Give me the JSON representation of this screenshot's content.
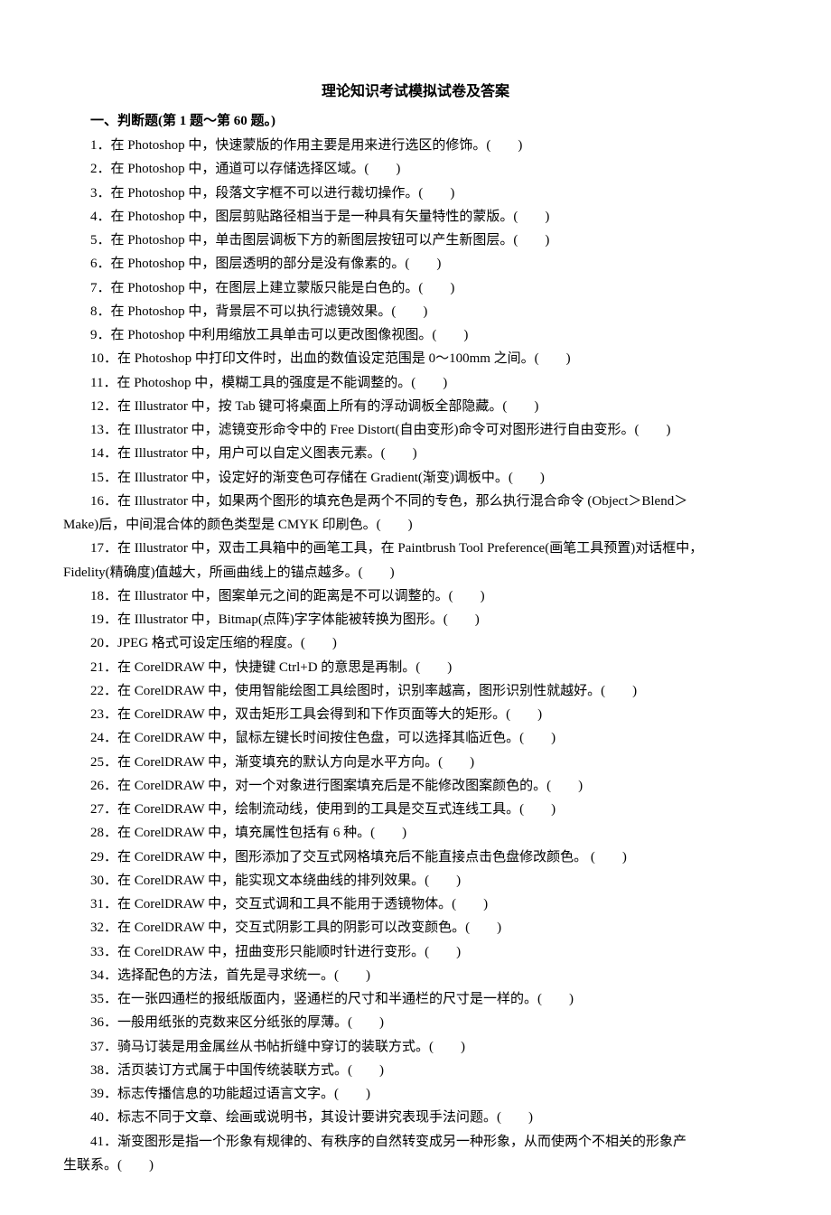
{
  "title": "理论知识考试模拟试卷及答案",
  "section_header": "一、判断题(第 1 题～第 60 题。)",
  "questions": {
    "q1": "1．在 Photoshop 中，快速蒙版的作用主要是用来进行选区的修饰。(　　)",
    "q2": "2．在 Photoshop 中，通道可以存储选择区域。(　　)",
    "q3": "3．在 Photoshop 中，段落文字框不可以进行裁切操作。(　　)",
    "q4": "4．在 Photoshop 中，图层剪贴路径相当于是一种具有矢量特性的蒙版。(　　)",
    "q5": "5．在 Photoshop 中，单击图层调板下方的新图层按钮可以产生新图层。(　　)",
    "q6": "6．在 Photoshop 中，图层透明的部分是没有像素的。(　　)",
    "q7": "7．在 Photoshop 中，在图层上建立蒙版只能是白色的。(　　)",
    "q8": "8．在 Photoshop 中，背景层不可以执行滤镜效果。(　　)",
    "q9": "9．在 Photoshop 中利用缩放工具单击可以更改图像视图。(　　)",
    "q10": "10．在 Photoshop 中打印文件时，出血的数值设定范围是 0～100mm 之间。(　　)",
    "q11": "11．在 Photoshop 中，模糊工具的强度是不能调整的。(　　)",
    "q12": "12．在 Illustrator 中，按 Tab 键可将桌面上所有的浮动调板全部隐藏。(　　)",
    "q13": "13．在 Illustrator 中，滤镜变形命令中的 Free Distort(自由变形)命令可对图形进行自由变形。(　　)",
    "q14": "14．在 Illustrator 中，用户可以自定义图表元素。(　　)",
    "q15": "15．在 Illustrator 中，设定好的渐变色可存储在 Gradient(渐变)调板中。(　　)",
    "q16a": "16．在 Illustrator 中，如果两个图形的填充色是两个不同的专色，那么执行混合命令 (Object＞Blend＞",
    "q16b": "Make)后，中间混合体的颜色类型是 CMYK 印刷色。(　　)",
    "q17a": "17．在 Illustrator 中，双击工具箱中的画笔工具，在 Paintbrush Tool Preference(画笔工具预置)对话框中，",
    "q17b": "Fidelity(精确度)值越大，所画曲线上的锚点越多。(　　)",
    "q18": "18．在 Illustrator 中，图案单元之间的距离是不可以调整的。(　　)",
    "q19": "19．在 Illustrator 中，Bitmap(点阵)字字体能被转换为图形。(　　)",
    "q20": "20．JPEG 格式可设定压缩的程度。(　　)",
    "q21": "21．在 CorelDRAW 中，快捷键 Ctrl+D 的意思是再制。(　　)",
    "q22": "22．在 CorelDRAW 中，使用智能绘图工具绘图时，识别率越高，图形识别性就越好。(　　)",
    "q23": "23．在 CorelDRAW 中，双击矩形工具会得到和下作页面等大的矩形。(　　)",
    "q24": "24．在 CorelDRAW 中，鼠标左键长时间按住色盘，可以选择其临近色。(　　)",
    "q25": "25．在 CorelDRAW 中，渐变填充的默认方向是水平方向。(　　)",
    "q26": "26．在 CorelDRAW 中，对一个对象进行图案填充后是不能修改图案颜色的。(　　)",
    "q27": "27．在 CorelDRAW 中，绘制流动线，使用到的工具是交互式连线工具。(　　)",
    "q28": "28．在 CorelDRAW 中，填充属性包括有 6 种。(　　)",
    "q29": "29．在 CorelDRAW 中，图形添加了交互式网格填充后不能直接点击色盘修改颜色。 (　　)",
    "q30": "30．在 CorelDRAW 中，能实现文本绕曲线的排列效果。(　　)",
    "q31": "31．在 CorelDRAW 中，交互式调和工具不能用于透镜物体。(　　)",
    "q32": "32．在 CorelDRAW 中，交互式阴影工具的阴影可以改变颜色。(　　)",
    "q33": "33．在 CorelDRAW 中，扭曲变形只能顺时针进行变形。(　　)",
    "q34": "34．选择配色的方法，首先是寻求统一。(　　)",
    "q35": "35．在一张四通栏的报纸版面内，竖通栏的尺寸和半通栏的尺寸是一样的。(　　)",
    "q36": "36．一般用纸张的克数来区分纸张的厚薄。(　　)",
    "q37": "37．骑马订装是用金属丝从书帖折缝中穿订的装联方式。(　　)",
    "q38": "38．活页装订方式属于中国传统装联方式。(　　)",
    "q39": "39．标志传播信息的功能超过语言文字。(　　)",
    "q40": "40．标志不同于文章、绘画或说明书，其设计要讲究表现手法问题。(　　)",
    "q41a": "41．渐变图形是指一个形象有规律的、有秩序的自然转变成另一种形象，从而使两个不相关的形象产",
    "q41b": "生联系。(　　)"
  }
}
